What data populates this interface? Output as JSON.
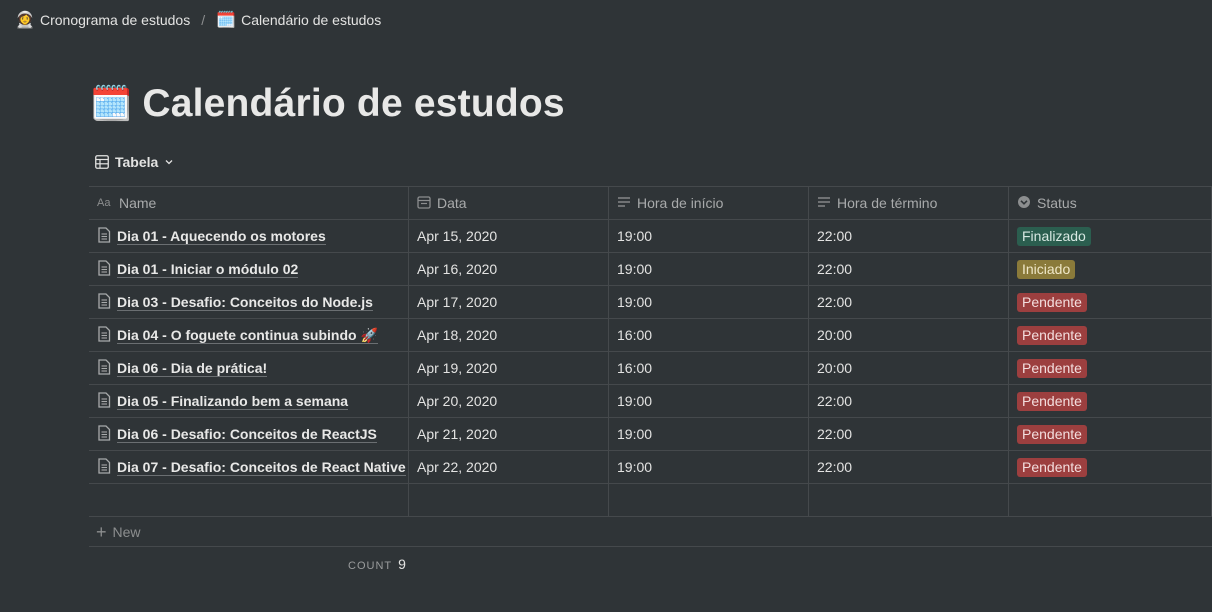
{
  "breadcrumb": {
    "items": [
      {
        "emoji": "👩‍🚀",
        "label": "Cronograma de estudos"
      },
      {
        "emoji": "🗓️",
        "label": "Calendário de estudos"
      }
    ],
    "separator": "/"
  },
  "page": {
    "emoji": "🗓️",
    "title": "Calendário de estudos"
  },
  "view": {
    "label": "Tabela",
    "icon": "table-icon"
  },
  "table": {
    "columns": [
      {
        "label": "Name",
        "icon": "text-type-icon"
      },
      {
        "label": "Data",
        "icon": "calendar-icon"
      },
      {
        "label": "Hora de início",
        "icon": "text-lines-icon"
      },
      {
        "label": "Hora de término",
        "icon": "text-lines-icon"
      },
      {
        "label": "Status",
        "icon": "select-icon"
      }
    ],
    "rows": [
      {
        "name": "Dia 01 - Aquecendo os motores",
        "date": "Apr 15, 2020",
        "start": "19:00",
        "end": "22:00",
        "status": "Finalizado"
      },
      {
        "name": "Dia 01 - Iniciar o módulo 02",
        "date": "Apr 16, 2020",
        "start": "19:00",
        "end": "22:00",
        "status": "Iniciado"
      },
      {
        "name": "Dia 03 - Desafio: Conceitos do Node.js",
        "date": "Apr 17, 2020",
        "start": "19:00",
        "end": "22:00",
        "status": "Pendente"
      },
      {
        "name": "Dia 04 - O foguete continua subindo 🚀",
        "date": "Apr 18, 2020",
        "start": "16:00",
        "end": "20:00",
        "status": "Pendente"
      },
      {
        "name": "Dia 06 - Dia de prática!",
        "date": "Apr 19, 2020",
        "start": "16:00",
        "end": "20:00",
        "status": "Pendente"
      },
      {
        "name": "Dia 05 - Finalizando bem a semana",
        "date": "Apr 20, 2020",
        "start": "19:00",
        "end": "22:00",
        "status": "Pendente"
      },
      {
        "name": "Dia 06 - Desafio: Conceitos de ReactJS",
        "date": "Apr 21, 2020",
        "start": "19:00",
        "end": "22:00",
        "status": "Pendente"
      },
      {
        "name": "Dia 07 - Desafio: Conceitos de React Native",
        "date": "Apr 22, 2020",
        "start": "19:00",
        "end": "22:00",
        "status": "Pendente"
      }
    ],
    "new_label": "New",
    "count_label": "COUNT",
    "count_value": "9"
  },
  "status_colors": {
    "Finalizado": {
      "bg": "#2b5e4f",
      "fg": "#d7e8e2"
    },
    "Iniciado": {
      "bg": "#8a7a3a",
      "fg": "#f0e8c8"
    },
    "Pendente": {
      "bg": "#9c3f3f",
      "fg": "#f3dede"
    }
  }
}
